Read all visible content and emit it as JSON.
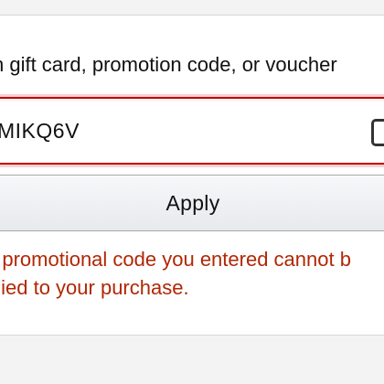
{
  "promo": {
    "label": "n gift card, promotion code, or voucher",
    "code_value": "MIKQ6V",
    "apply_label": "Apply",
    "error_line_1": "e promotional code you entered cannot b",
    "error_line_2": "plied to your purchase."
  },
  "colors": {
    "error": "#b12704",
    "input_border": "#c40000",
    "band": "#f3f3f3"
  },
  "icons": {
    "scan": "camera-scan-icon"
  }
}
